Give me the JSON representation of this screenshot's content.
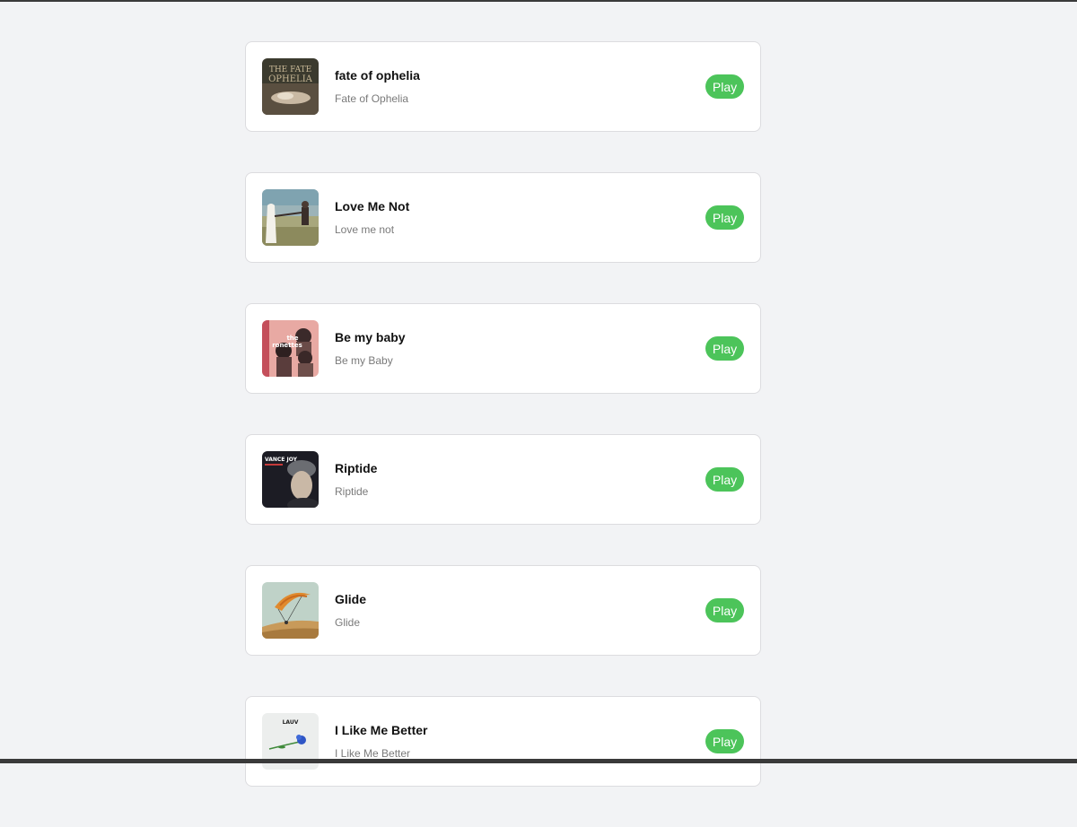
{
  "accent_color": "#4cc45a",
  "songs": [
    {
      "title": "fate of ophelia",
      "subtitle": "Fate of Ophelia",
      "play_label": "Play",
      "cover_lettering": "THE FATE OF OPHELIA"
    },
    {
      "title": "Love Me Not",
      "subtitle": "Love me not",
      "play_label": "Play"
    },
    {
      "title": "Be my baby",
      "subtitle": "Be my Baby",
      "play_label": "Play",
      "cover_lettering": "the ronettes"
    },
    {
      "title": "Riptide",
      "subtitle": "Riptide",
      "play_label": "Play",
      "cover_lettering": "VANCE JOY"
    },
    {
      "title": "Glide",
      "subtitle": "Glide",
      "play_label": "Play"
    },
    {
      "title": "I Like Me Better",
      "subtitle": "I Like Me Better",
      "play_label": "Play",
      "cover_lettering": "LAUV"
    }
  ]
}
